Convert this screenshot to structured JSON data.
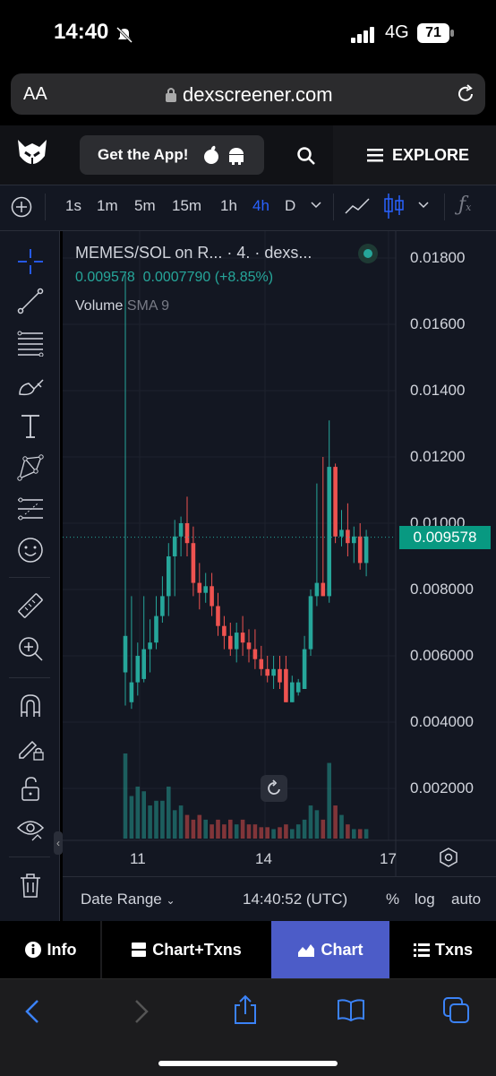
{
  "status_bar": {
    "time": "14:40",
    "network": "4G",
    "battery": "71"
  },
  "browser": {
    "text_size": "AA",
    "url": "dexscreener.com"
  },
  "header": {
    "get_app": "Get the App!",
    "explore": "EXPLORE"
  },
  "toolbar": {
    "timeframes": [
      "1s",
      "1m",
      "5m",
      "15m",
      "1h",
      "4h",
      "D"
    ],
    "active_timeframe": "4h"
  },
  "legend": {
    "title": "MEMES/SOL on R... · 4. · dexs...",
    "price": "0.009578",
    "change": "0.0007790 (+8.85%)",
    "volume_label": "Volume",
    "sma_label": "SMA 9"
  },
  "y_axis_ticks": [
    "0.01800",
    "0.01600",
    "0.01400",
    "0.01200",
    "0.01000",
    "0.008000",
    "0.006000",
    "0.004000",
    "0.002000"
  ],
  "current_price_tag": "0.009578",
  "x_axis_ticks": [
    "11",
    "14",
    "17"
  ],
  "bottom": {
    "date_range": "Date Range",
    "clock": "14:40:52 (UTC)",
    "percent": "%",
    "log": "log",
    "auto": "auto"
  },
  "tabs": {
    "info": "Info",
    "chart_txns": "Chart+Txns",
    "chart": "Chart",
    "txns": "Txns"
  },
  "colors": {
    "up": "#26a69a",
    "down": "#ef5350",
    "accent": "#2962ff",
    "active_tab": "#4c5cc8"
  },
  "chart_data": {
    "type": "candlestick",
    "ylim": [
      0.0,
      0.0185
    ],
    "candles": [
      {
        "o": 0.0055,
        "h": 0.0175,
        "l": 0.0045,
        "c": 0.0066,
        "v": 0.9
      },
      {
        "o": 0.0046,
        "h": 0.0078,
        "l": 0.0044,
        "c": 0.0052,
        "v": 0.45
      },
      {
        "o": 0.0052,
        "h": 0.0064,
        "l": 0.0048,
        "c": 0.006,
        "v": 0.55
      },
      {
        "o": 0.0053,
        "h": 0.0078,
        "l": 0.0052,
        "c": 0.0062,
        "v": 0.5
      },
      {
        "o": 0.0062,
        "h": 0.0071,
        "l": 0.0055,
        "c": 0.0064,
        "v": 0.35
      },
      {
        "o": 0.0064,
        "h": 0.0078,
        "l": 0.0062,
        "c": 0.0072,
        "v": 0.4
      },
      {
        "o": 0.0072,
        "h": 0.0084,
        "l": 0.007,
        "c": 0.0078,
        "v": 0.4
      },
      {
        "o": 0.0078,
        "h": 0.0094,
        "l": 0.0072,
        "c": 0.009,
        "v": 0.55
      },
      {
        "o": 0.009,
        "h": 0.0101,
        "l": 0.0078,
        "c": 0.0096,
        "v": 0.3
      },
      {
        "o": 0.0096,
        "h": 0.0102,
        "l": 0.009,
        "c": 0.01,
        "v": 0.35
      },
      {
        "o": 0.01,
        "h": 0.0108,
        "l": 0.009,
        "c": 0.0094,
        "v": 0.25
      },
      {
        "o": 0.0094,
        "h": 0.0099,
        "l": 0.0078,
        "c": 0.0082,
        "v": 0.2
      },
      {
        "o": 0.0082,
        "h": 0.0088,
        "l": 0.0074,
        "c": 0.0079,
        "v": 0.25
      },
      {
        "o": 0.0079,
        "h": 0.0085,
        "l": 0.0076,
        "c": 0.0081,
        "v": 0.2
      },
      {
        "o": 0.0081,
        "h": 0.0085,
        "l": 0.0072,
        "c": 0.0075,
        "v": 0.15
      },
      {
        "o": 0.0075,
        "h": 0.0079,
        "l": 0.0066,
        "c": 0.0069,
        "v": 0.2
      },
      {
        "o": 0.0069,
        "h": 0.0072,
        "l": 0.0062,
        "c": 0.0066,
        "v": 0.15
      },
      {
        "o": 0.0066,
        "h": 0.007,
        "l": 0.006,
        "c": 0.0062,
        "v": 0.2
      },
      {
        "o": 0.0062,
        "h": 0.007,
        "l": 0.0058,
        "c": 0.0067,
        "v": 0.15
      },
      {
        "o": 0.0067,
        "h": 0.0072,
        "l": 0.006,
        "c": 0.0064,
        "v": 0.2
      },
      {
        "o": 0.0064,
        "h": 0.0068,
        "l": 0.0058,
        "c": 0.0062,
        "v": 0.15
      },
      {
        "o": 0.0062,
        "h": 0.0068,
        "l": 0.0056,
        "c": 0.0059,
        "v": 0.15
      },
      {
        "o": 0.0059,
        "h": 0.0063,
        "l": 0.0054,
        "c": 0.0056,
        "v": 0.12
      },
      {
        "o": 0.0056,
        "h": 0.006,
        "l": 0.0052,
        "c": 0.0054,
        "v": 0.12
      },
      {
        "o": 0.0054,
        "h": 0.006,
        "l": 0.005,
        "c": 0.0056,
        "v": 0.1
      },
      {
        "o": 0.0056,
        "h": 0.006,
        "l": 0.005,
        "c": 0.0052,
        "v": 0.12
      },
      {
        "o": 0.0056,
        "h": 0.006,
        "l": 0.0046,
        "c": 0.0046,
        "v": 0.15
      },
      {
        "o": 0.0046,
        "h": 0.0054,
        "l": 0.0046,
        "c": 0.0052,
        "v": 0.1
      },
      {
        "o": 0.0049,
        "h": 0.0053,
        "l": 0.0048,
        "c": 0.0052,
        "v": 0.15
      },
      {
        "o": 0.005,
        "h": 0.0066,
        "l": 0.005,
        "c": 0.0062,
        "v": 0.2
      },
      {
        "o": 0.0062,
        "h": 0.008,
        "l": 0.006,
        "c": 0.0078,
        "v": 0.35
      },
      {
        "o": 0.0078,
        "h": 0.0112,
        "l": 0.0075,
        "c": 0.0082,
        "v": 0.3
      },
      {
        "o": 0.0082,
        "h": 0.012,
        "l": 0.0078,
        "c": 0.0078,
        "v": 0.2
      },
      {
        "o": 0.0078,
        "h": 0.0131,
        "l": 0.0076,
        "c": 0.0117,
        "v": 0.8
      },
      {
        "o": 0.0117,
        "h": 0.0118,
        "l": 0.0094,
        "c": 0.0096,
        "v": 0.35
      },
      {
        "o": 0.0096,
        "h": 0.0104,
        "l": 0.0093,
        "c": 0.0098,
        "v": 0.25
      },
      {
        "o": 0.0098,
        "h": 0.0106,
        "l": 0.009,
        "c": 0.0094,
        "v": 0.15
      },
      {
        "o": 0.0094,
        "h": 0.0099,
        "l": 0.0088,
        "c": 0.0096,
        "v": 0.1
      },
      {
        "o": 0.0096,
        "h": 0.01,
        "l": 0.0086,
        "c": 0.0088,
        "v": 0.1
      },
      {
        "o": 0.0088,
        "h": 0.0098,
        "l": 0.0084,
        "c": 0.0096,
        "v": 0.1
      }
    ],
    "current_price": 0.009578,
    "x_ticks": [
      "11",
      "14",
      "17"
    ]
  }
}
